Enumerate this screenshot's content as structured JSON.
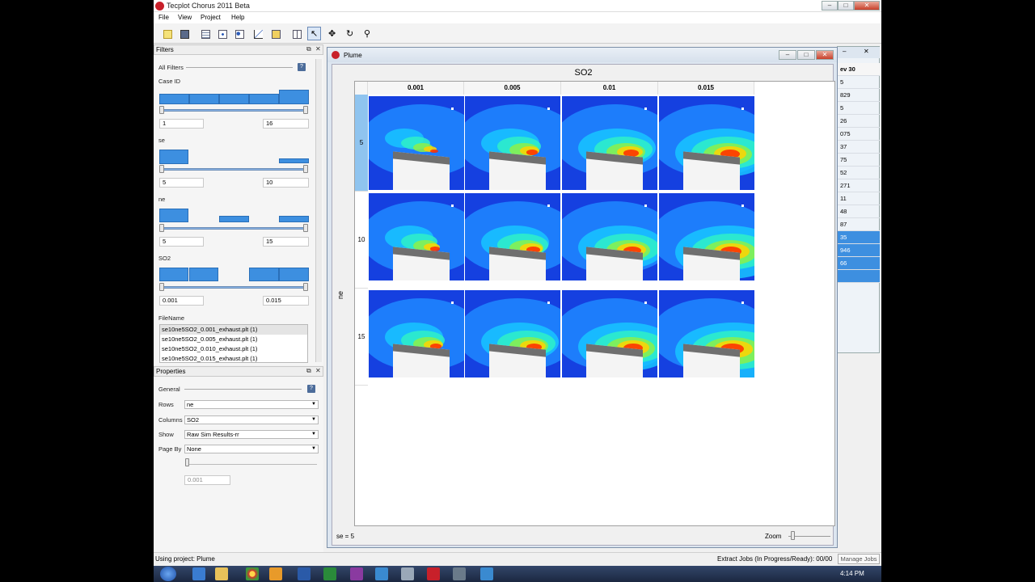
{
  "app": {
    "title": "Tecplot Chorus 2011 Beta",
    "menu": [
      "File",
      "View",
      "Project",
      "Help"
    ],
    "toolbar_icons": [
      "new-project-icon",
      "save-icon",
      "table-view-icon",
      "scatter-view-icon",
      "cluster-view-icon",
      "line-plot-icon",
      "matrix-view-icon",
      "grid-layout-icon",
      "pointer-icon",
      "pan-icon",
      "rotate-icon",
      "zoom-icon"
    ]
  },
  "filters_panel": {
    "title": "Filters",
    "all_filters": "All Filters",
    "help": "?",
    "filters": [
      {
        "name": "Case ID",
        "min": "1",
        "max": "16"
      },
      {
        "name": "se",
        "min": "5",
        "max": "10"
      },
      {
        "name": "ne",
        "min": "5",
        "max": "15"
      },
      {
        "name": "SO2",
        "min": "0.001",
        "max": "0.015"
      }
    ],
    "filename_label": "FileName",
    "files": [
      "se10ne5SO2_0.001_exhaust.plt (1)",
      "se10ne5SO2_0.005_exhaust.plt (1)",
      "se10ne5SO2_0.010_exhaust.plt (1)",
      "se10ne5SO2_0.015_exhaust.plt (1)"
    ]
  },
  "properties_panel": {
    "title": "Properties",
    "general": "General",
    "help": "?",
    "rows_label": "Rows",
    "rows_value": "ne",
    "columns_label": "Columns",
    "columns_value": "SO2",
    "show_label": "Show",
    "show_value": "Raw Sim Results-rr",
    "pageby_label": "Page By",
    "pageby_value": "None",
    "page_value": "0.001"
  },
  "plume": {
    "title": "Plume",
    "column_var": "SO2",
    "row_var": "ne",
    "columns": [
      "0.001",
      "0.005",
      "0.01",
      "0.015"
    ],
    "rows": [
      "5",
      "10",
      "15"
    ],
    "footer": "se = 5",
    "zoom_label": "Zoom"
  },
  "background_window": {
    "header": "ev 30",
    "values": [
      "5",
      "829",
      "5",
      "26",
      "075",
      "37",
      "75",
      "52",
      "271",
      "11",
      "48",
      "87",
      "35",
      "946",
      "66",
      ""
    ]
  },
  "status": {
    "project": "Using project: Plume",
    "jobs": "Extract Jobs (In Progress/Ready):  00/00",
    "manage": "Manage Jobs"
  },
  "taskbar": {
    "clock": "4:14 PM"
  },
  "colors": {
    "selection_blue": "#3d8fe0",
    "plume_low": "#1540e0",
    "plume_high": "#ff2a00"
  }
}
